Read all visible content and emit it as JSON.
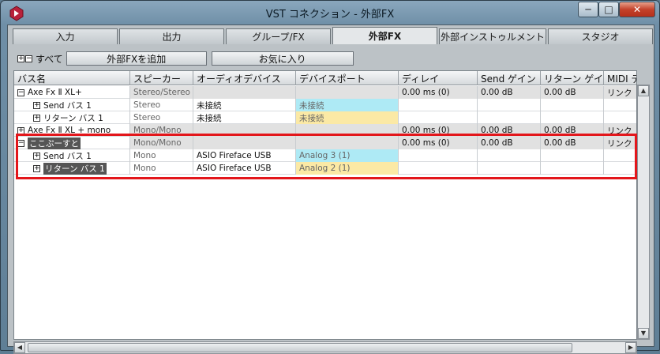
{
  "window": {
    "title": "VST コネクション - 外部FX",
    "controls": {
      "minimize": "─",
      "maximize": "□",
      "close": "✕"
    }
  },
  "tabs": [
    {
      "label": "入力"
    },
    {
      "label": "出力"
    },
    {
      "label": "グループ/FX"
    },
    {
      "label": "外部FX",
      "active": true
    },
    {
      "label": "外部インストゥルメント"
    },
    {
      "label": "スタジオ"
    }
  ],
  "toolbar": {
    "expand_all": "+",
    "collapse_all": "−",
    "all_label": "すべて",
    "add_external_fx": "外部FXを追加",
    "favorites": "お気に入り"
  },
  "columns": [
    "バス名",
    "スピーカー",
    "オーディオデバイス",
    "デバイスポート",
    "ディレイ",
    "Send ゲイン",
    "リターン ゲイン",
    "MIDI デバイス"
  ],
  "rows": [
    {
      "indent": 0,
      "toggle": "−",
      "name": "Axe Fx Ⅱ XL+",
      "speaker": "Stereo/Stereo",
      "device": "",
      "port": "",
      "delay": "0.00 ms (0)",
      "send_gain": "0.00 dB",
      "return_gain": "0.00 dB",
      "midi": "リンク",
      "kind": "bus"
    },
    {
      "indent": 1,
      "toggle": "+",
      "name": "Send バス 1",
      "speaker": "Stereo",
      "device": "未接続",
      "port": "未接続",
      "delay": "",
      "send_gain": "",
      "return_gain": "",
      "midi": "",
      "kind": "send"
    },
    {
      "indent": 1,
      "toggle": "+",
      "name": "リターン バス 1",
      "speaker": "Stereo",
      "device": "未接続",
      "port": "未接続",
      "delay": "",
      "send_gain": "",
      "return_gain": "",
      "midi": "",
      "kind": "return"
    },
    {
      "indent": 0,
      "toggle": "+",
      "name": "Axe Fx Ⅱ XL + mono",
      "speaker": "Mono/Mono",
      "device": "",
      "port": "",
      "delay": "0.00 ms (0)",
      "send_gain": "0.00 dB",
      "return_gain": "0.00 dB",
      "midi": "リンク",
      "kind": "bus"
    },
    {
      "indent": 0,
      "toggle": "−",
      "name": "ここぷーすと",
      "speaker": "Mono/Mono",
      "device": "",
      "port": "",
      "delay": "0.00 ms (0)",
      "send_gain": "0.00 dB",
      "return_gain": "0.00 dB",
      "midi": "リンク",
      "kind": "bus",
      "selected": true
    },
    {
      "indent": 1,
      "toggle": "+",
      "name": "Send バス 1",
      "speaker": "Mono",
      "device": "ASIO Fireface USB",
      "port": "Analog 3 (1)",
      "delay": "",
      "send_gain": "",
      "return_gain": "",
      "midi": "",
      "kind": "send"
    },
    {
      "indent": 1,
      "toggle": "+",
      "name": "リターン バス 1",
      "speaker": "Mono",
      "device": "ASIO Fireface USB",
      "port": "Analog 2 (1)",
      "delay": "",
      "send_gain": "",
      "return_gain": "",
      "midi": "",
      "kind": "return",
      "selected": true
    }
  ],
  "scroll": {
    "up": "▲",
    "down": "▼",
    "left": "◀",
    "right": "▶"
  },
  "colors": {
    "send_port": "#aeeaf5",
    "return_port": "#fbe9a5",
    "highlight": "#e3161b"
  }
}
